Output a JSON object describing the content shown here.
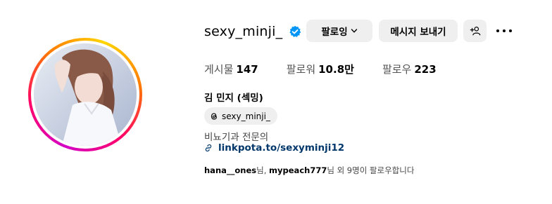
{
  "profile": {
    "username": "sexy_minji_",
    "verified_icon": "verified-badge-icon",
    "full_name": "김 민지 (섹밍)",
    "threads_handle": "sexy_minji_",
    "bio": "비뇨기과 전문의",
    "link": "linkpota.to/sexyminji12"
  },
  "buttons": {
    "follow_label": "팔로잉",
    "message_label": "메시지 보내기",
    "suggest_icon": "add-person-icon",
    "more_icon": "more-options-icon"
  },
  "stats": {
    "posts_label": "게시물",
    "posts_value": "147",
    "followers_label": "팔로워",
    "followers_value": "10.8만",
    "following_label": "팔로우",
    "following_value": "223"
  },
  "followed_by": {
    "user1": "hana__ones",
    "sep1": "님, ",
    "user2": "mypeach777",
    "suffix": "님 외 9명이 팔로우합니다"
  },
  "colors": {
    "accent_blue": "#0095f6",
    "link": "#00376b",
    "button_bg": "#efefef"
  }
}
